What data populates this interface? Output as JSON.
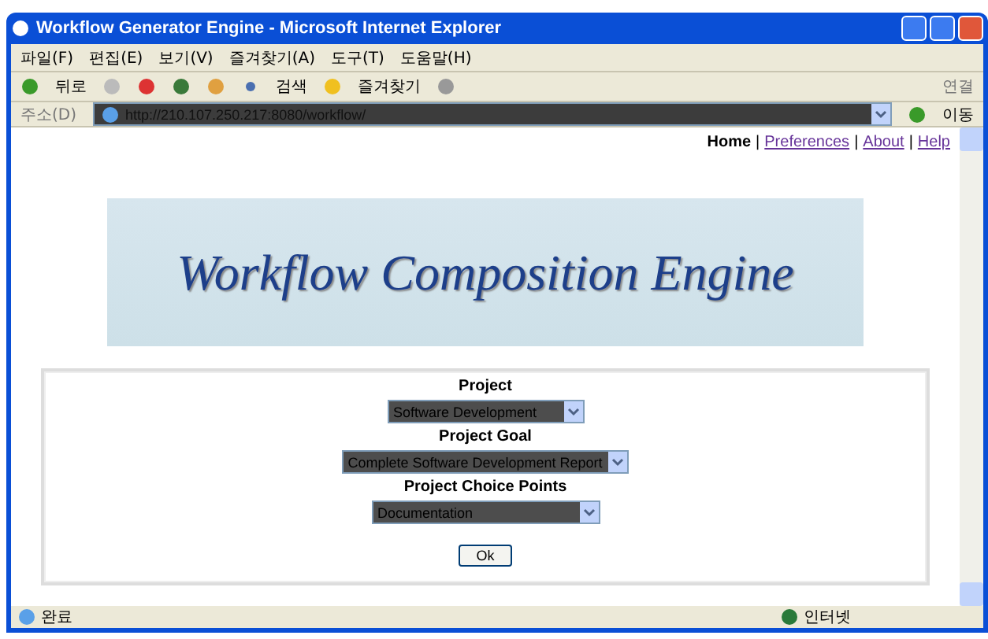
{
  "window": {
    "title": "Workflow Generator Engine - Microsoft Internet Explorer"
  },
  "menu": [
    "파일(F)",
    "편집(E)",
    "보기(V)",
    "즐겨찾기(A)",
    "도구(T)",
    "도움말(H)"
  ],
  "toolbar": {
    "back": "뒤로",
    "search": "검색",
    "favorites": "즐겨찾기",
    "links": "연결"
  },
  "address": {
    "label": "주소(D)",
    "value": "http://210.107.250.217:8080/workflow/",
    "go": "이동"
  },
  "nav": [
    {
      "label": "Home",
      "selected": true
    },
    {
      "label": "Preferences",
      "selected": false
    },
    {
      "label": "About",
      "selected": false
    },
    {
      "label": "Help",
      "selected": false
    }
  ],
  "nav_separators": [
    "|",
    "|",
    "|"
  ],
  "banner": {
    "title": "Workflow Composition Engine"
  },
  "form": {
    "fields": [
      {
        "label": "Project",
        "value": "Software Development"
      },
      {
        "label": "Project Goal",
        "value": "Complete Software Development Report"
      },
      {
        "label": "Project Choice Points",
        "value": "Documentation"
      }
    ],
    "submit": "Ok"
  },
  "status_bar": {
    "text": "완료",
    "zone": "인터넷"
  }
}
